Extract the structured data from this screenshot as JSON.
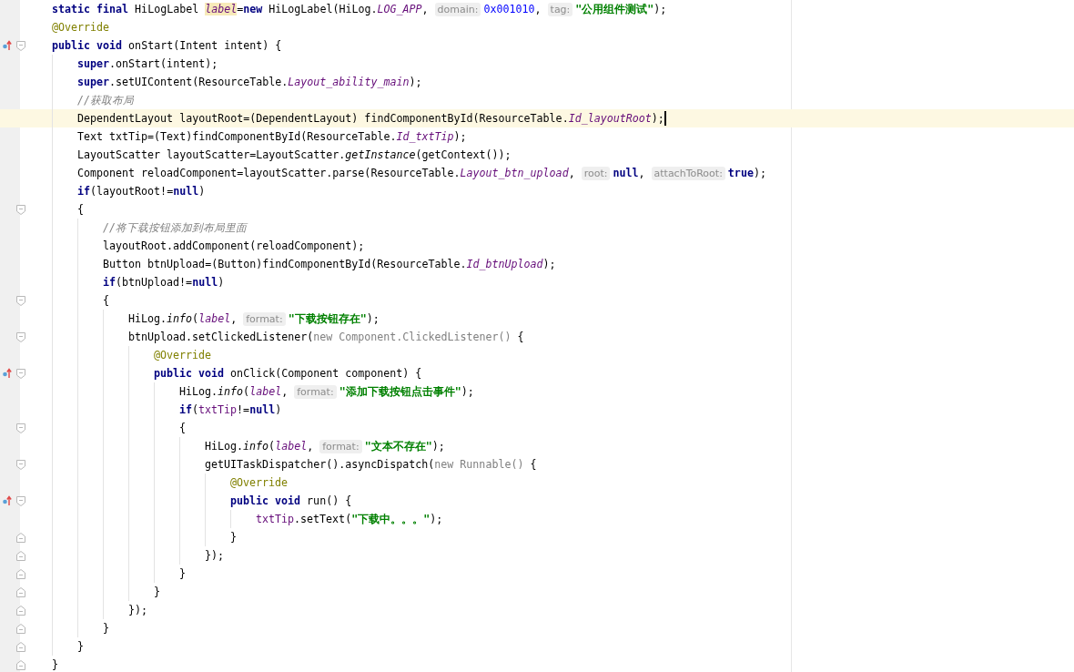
{
  "lines": [
    {
      "tokens": [
        {
          "kind": "keyword",
          "text": "static final "
        },
        {
          "kind": "plain",
          "text": "HiLogLabel "
        },
        {
          "kind": "field",
          "text": "label",
          "highlighted": true
        },
        {
          "kind": "plain",
          "text": "="
        },
        {
          "kind": "keyword",
          "text": "new "
        },
        {
          "kind": "plain",
          "text": "HiLogLabel(HiLog."
        },
        {
          "kind": "field",
          "text": "LOG_APP"
        },
        {
          "kind": "plain",
          "text": ", "
        },
        {
          "kind": "hint",
          "text": "domain:"
        },
        {
          "kind": "number",
          "text": "0x001010"
        },
        {
          "kind": "plain",
          "text": ", "
        },
        {
          "kind": "hint",
          "text": "tag:"
        },
        {
          "kind": "string",
          "text": "\"公用组件测试\""
        },
        {
          "kind": "plain",
          "text": ");"
        }
      ]
    },
    {
      "tokens": [
        {
          "kind": "annotation",
          "text": "@Override"
        }
      ]
    },
    {
      "override": true,
      "fold_start": true,
      "tokens": [
        {
          "kind": "keyword",
          "text": "public void "
        },
        {
          "kind": "plain",
          "text": "onStart(Intent intent) {"
        }
      ],
      "children": [
        {
          "tokens": [
            {
              "kind": "keyword",
              "text": "super"
            },
            {
              "kind": "plain",
              "text": ".onStart(intent);"
            }
          ]
        },
        {
          "tokens": [
            {
              "kind": "keyword",
              "text": "super"
            },
            {
              "kind": "plain",
              "text": ".setUIContent(ResourceTable."
            },
            {
              "kind": "field",
              "text": "Layout_ability_main"
            },
            {
              "kind": "plain",
              "text": ");"
            }
          ]
        },
        {
          "tokens": [
            {
              "kind": "comment",
              "text": "//获取布局"
            }
          ]
        },
        {
          "current": true,
          "tokens": [
            {
              "kind": "plain",
              "text": "DependentLayout layoutRoot=(DependentLayout) findComponentById(ResourceTable."
            },
            {
              "kind": "field",
              "text": "Id_layoutRoot"
            },
            {
              "kind": "plain",
              "text": ");"
            }
          ]
        },
        {
          "tokens": [
            {
              "kind": "plain",
              "text": "Text txtTip=(Text)findComponentById(ResourceTable."
            },
            {
              "kind": "field",
              "text": "Id_txtTip"
            },
            {
              "kind": "plain",
              "text": ");"
            }
          ]
        },
        {
          "tokens": [
            {
              "kind": "plain",
              "text": "LayoutScatter layoutScatter=LayoutScatter."
            },
            {
              "kind": "static",
              "text": "getInstance"
            },
            {
              "kind": "plain",
              "text": "(getContext());"
            }
          ]
        },
        {
          "tokens": [
            {
              "kind": "plain",
              "text": "Component reloadComponent=layoutScatter.parse(ResourceTable."
            },
            {
              "kind": "field",
              "text": "Layout_btn_upload"
            },
            {
              "kind": "plain",
              "text": ", "
            },
            {
              "kind": "hint",
              "text": "root:"
            },
            {
              "kind": "keyword",
              "text": "null"
            },
            {
              "kind": "plain",
              "text": ", "
            },
            {
              "kind": "hint",
              "text": "attachToRoot:"
            },
            {
              "kind": "keyword",
              "text": "true"
            },
            {
              "kind": "plain",
              "text": ");"
            }
          ]
        },
        {
          "tokens": [
            {
              "kind": "keyword",
              "text": "if"
            },
            {
              "kind": "plain",
              "text": "(layoutRoot!="
            },
            {
              "kind": "keyword",
              "text": "null"
            },
            {
              "kind": "plain",
              "text": ")"
            }
          ]
        },
        {
          "fold_start": true,
          "tokens": [
            {
              "kind": "plain",
              "text": "{"
            }
          ],
          "children": [
            {
              "tokens": [
                {
                  "kind": "comment",
                  "text": "//将下载按钮添加到布局里面"
                }
              ]
            },
            {
              "tokens": [
                {
                  "kind": "plain",
                  "text": "layoutRoot.addComponent(reloadComponent);"
                }
              ]
            },
            {
              "tokens": [
                {
                  "kind": "plain",
                  "text": "Button btnUpload=(Button)findComponentById(ResourceTable."
                },
                {
                  "kind": "field",
                  "text": "Id_btnUpload"
                },
                {
                  "kind": "plain",
                  "text": ");"
                }
              ]
            },
            {
              "tokens": [
                {
                  "kind": "keyword",
                  "text": "if"
                },
                {
                  "kind": "plain",
                  "text": "(btnUpload!="
                },
                {
                  "kind": "keyword",
                  "text": "null"
                },
                {
                  "kind": "plain",
                  "text": ")"
                }
              ]
            },
            {
              "fold_start": true,
              "tokens": [
                {
                  "kind": "plain",
                  "text": "{"
                }
              ],
              "children": [
                {
                  "tokens": [
                    {
                      "kind": "plain",
                      "text": "HiLog."
                    },
                    {
                      "kind": "static",
                      "text": "info"
                    },
                    {
                      "kind": "plain",
                      "text": "("
                    },
                    {
                      "kind": "field",
                      "text": "label"
                    },
                    {
                      "kind": "plain",
                      "text": ", "
                    },
                    {
                      "kind": "hint",
                      "text": "format:"
                    },
                    {
                      "kind": "string",
                      "text": "\"下载按钮存在\""
                    },
                    {
                      "kind": "plain",
                      "text": ");"
                    }
                  ]
                },
                {
                  "fold_start": true,
                  "tokens": [
                    {
                      "kind": "plain",
                      "text": "btnUpload.setClickedListener("
                    },
                    {
                      "kind": "anon",
                      "text": "new Component.ClickedListener()"
                    },
                    {
                      "kind": "plain",
                      "text": " {"
                    }
                  ],
                  "children": [
                    {
                      "tokens": [
                        {
                          "kind": "annotation",
                          "text": "@Override"
                        }
                      ]
                    },
                    {
                      "override": true,
                      "fold_start": true,
                      "tokens": [
                        {
                          "kind": "keyword",
                          "text": "public void "
                        },
                        {
                          "kind": "plain",
                          "text": "onClick(Component component) {"
                        }
                      ],
                      "children": [
                        {
                          "tokens": [
                            {
                              "kind": "plain",
                              "text": "HiLog."
                            },
                            {
                              "kind": "static",
                              "text": "info"
                            },
                            {
                              "kind": "plain",
                              "text": "("
                            },
                            {
                              "kind": "field",
                              "text": "label"
                            },
                            {
                              "kind": "plain",
                              "text": ", "
                            },
                            {
                              "kind": "hint",
                              "text": "format:"
                            },
                            {
                              "kind": "string",
                              "text": "\"添加下载按钮点击事件\""
                            },
                            {
                              "kind": "plain",
                              "text": ");"
                            }
                          ]
                        },
                        {
                          "tokens": [
                            {
                              "kind": "keyword",
                              "text": "if"
                            },
                            {
                              "kind": "plain",
                              "text": "("
                            },
                            {
                              "kind": "member",
                              "text": "txtTip"
                            },
                            {
                              "kind": "plain",
                              "text": "!="
                            },
                            {
                              "kind": "keyword",
                              "text": "null"
                            },
                            {
                              "kind": "plain",
                              "text": ")"
                            }
                          ]
                        },
                        {
                          "fold_start": true,
                          "tokens": [
                            {
                              "kind": "plain",
                              "text": "{"
                            }
                          ],
                          "children": [
                            {
                              "tokens": [
                                {
                                  "kind": "plain",
                                  "text": "HiLog."
                                },
                                {
                                  "kind": "static",
                                  "text": "info"
                                },
                                {
                                  "kind": "plain",
                                  "text": "("
                                },
                                {
                                  "kind": "field",
                                  "text": "label"
                                },
                                {
                                  "kind": "plain",
                                  "text": ", "
                                },
                                {
                                  "kind": "hint",
                                  "text": "format:"
                                },
                                {
                                  "kind": "string",
                                  "text": "\"文本不存在\""
                                },
                                {
                                  "kind": "plain",
                                  "text": ");"
                                }
                              ]
                            },
                            {
                              "fold_start": true,
                              "tokens": [
                                {
                                  "kind": "plain",
                                  "text": "getUITaskDispatcher().asyncDispatch("
                                },
                                {
                                  "kind": "anon",
                                  "text": "new Runnable()"
                                },
                                {
                                  "kind": "plain",
                                  "text": " {"
                                }
                              ],
                              "children": [
                                {
                                  "tokens": [
                                    {
                                      "kind": "annotation",
                                      "text": "@Override"
                                    }
                                  ]
                                },
                                {
                                  "override": true,
                                  "fold_start": true,
                                  "tokens": [
                                    {
                                      "kind": "keyword",
                                      "text": "public void "
                                    },
                                    {
                                      "kind": "plain",
                                      "text": "run() {"
                                    }
                                  ],
                                  "children": [
                                    {
                                      "tokens": [
                                        {
                                          "kind": "member",
                                          "text": "txtTip"
                                        },
                                        {
                                          "kind": "plain",
                                          "text": ".setText("
                                        },
                                        {
                                          "kind": "string",
                                          "text": "\"下载中。。。\""
                                        },
                                        {
                                          "kind": "plain",
                                          "text": ");"
                                        }
                                      ]
                                    }
                                  ]
                                },
                                {
                                  "fold_end": true,
                                  "tokens": [
                                    {
                                      "kind": "plain",
                                      "text": "}"
                                    }
                                  ]
                                }
                              ]
                            },
                            {
                              "fold_end": true,
                              "tokens": [
                                {
                                  "kind": "plain",
                                  "text": "});"
                                }
                              ]
                            }
                          ]
                        },
                        {
                          "fold_end": true,
                          "tokens": [
                            {
                              "kind": "plain",
                              "text": "}"
                            }
                          ]
                        }
                      ]
                    },
                    {
                      "fold_end": true,
                      "tokens": [
                        {
                          "kind": "plain",
                          "text": "}"
                        }
                      ]
                    }
                  ]
                },
                {
                  "fold_end": true,
                  "tokens": [
                    {
                      "kind": "plain",
                      "text": "});"
                    }
                  ]
                }
              ]
            },
            {
              "fold_end": true,
              "tokens": [
                {
                  "kind": "plain",
                  "text": "}"
                }
              ]
            }
          ]
        },
        {
          "fold_end": true,
          "tokens": [
            {
              "kind": "plain",
              "text": "}"
            }
          ]
        }
      ]
    },
    {
      "fold_end": true,
      "tokens": [
        {
          "kind": "plain",
          "text": "}"
        }
      ]
    }
  ]
}
